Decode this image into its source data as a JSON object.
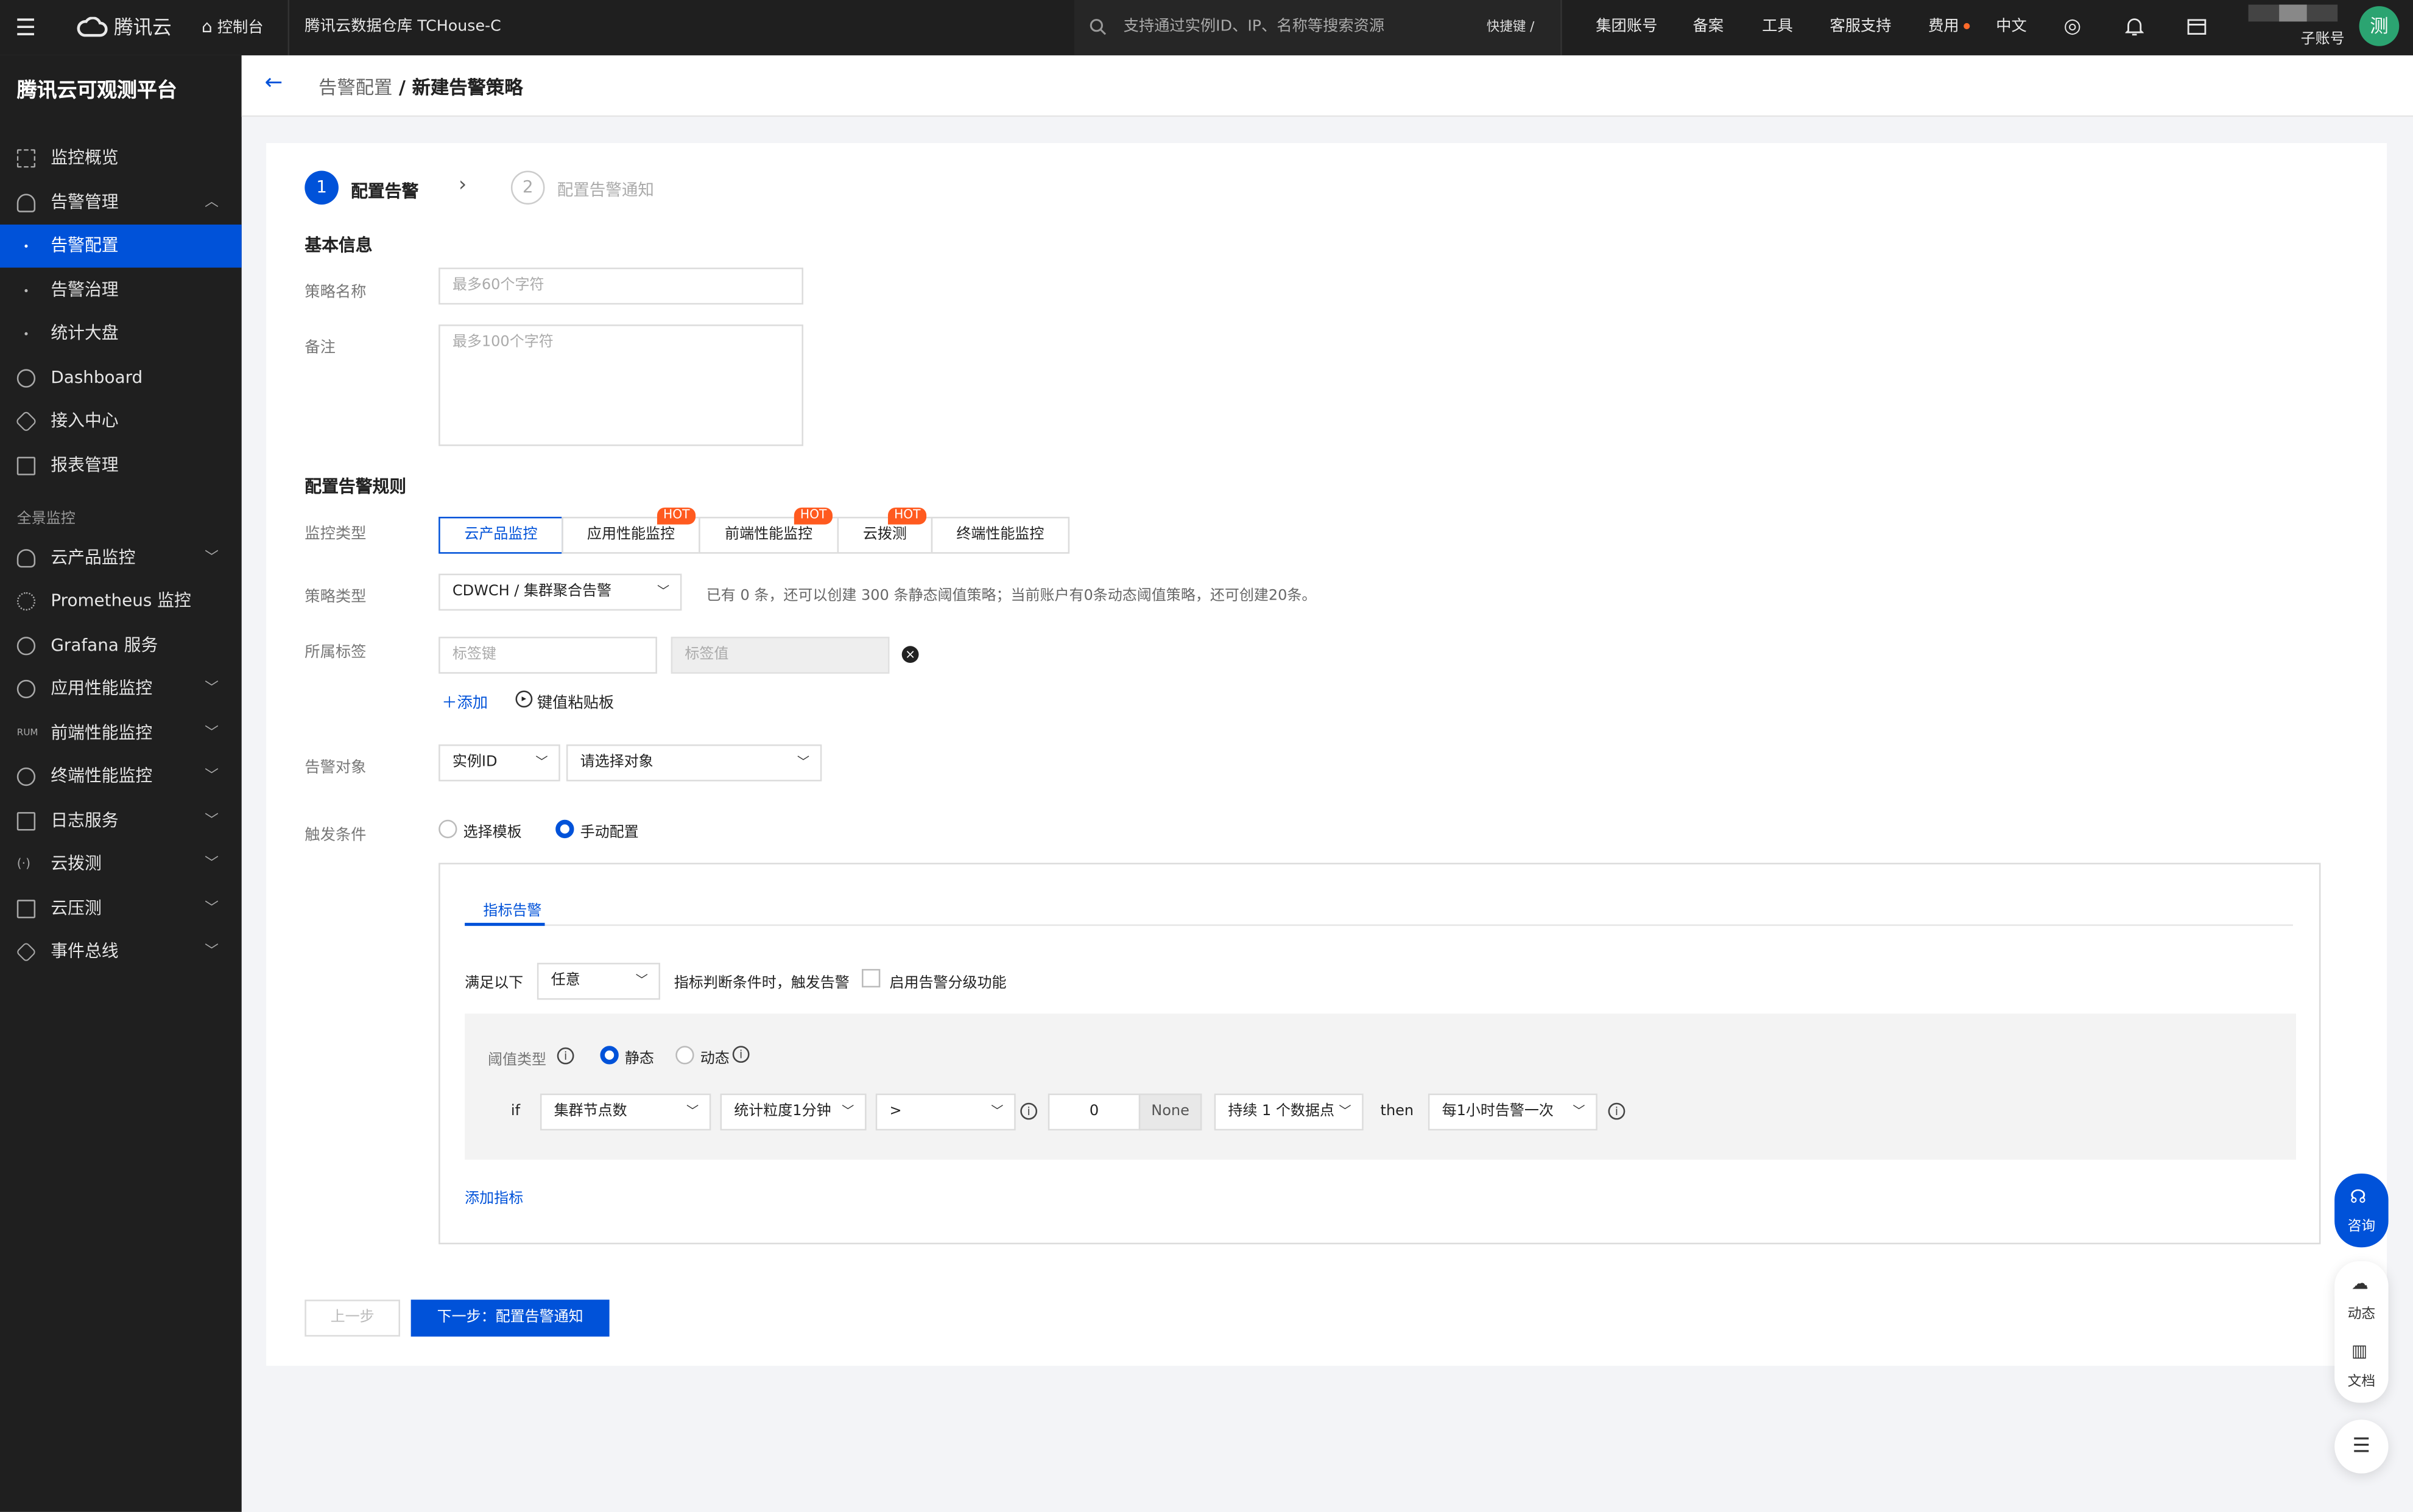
{
  "topbar": {
    "brand": "腾讯云",
    "console": "控制台",
    "product": "腾讯云数据仓库 TCHouse-C",
    "search_placeholder": "支持通过实例ID、IP、名称等搜索资源",
    "shortcut": "快捷键 /",
    "links": [
      "集团账号",
      "备案",
      "工具",
      "客服支持",
      "费用",
      "中文"
    ],
    "account": "子账号",
    "avatar": "测"
  },
  "sidebar": {
    "title": "腾讯云可观测平台",
    "items": [
      {
        "label": "监控概览"
      },
      {
        "label": "告警管理"
      },
      {
        "label": "告警配置"
      },
      {
        "label": "告警治理"
      },
      {
        "label": "统计大盘"
      },
      {
        "label": "Dashboard"
      },
      {
        "label": "接入中心"
      },
      {
        "label": "报表管理"
      }
    ],
    "group_label": "全景监控",
    "group_items": [
      {
        "label": "云产品监控"
      },
      {
        "label": "Prometheus 监控"
      },
      {
        "label": "Grafana 服务"
      },
      {
        "label": "应用性能监控"
      },
      {
        "label": "前端性能监控"
      },
      {
        "label": "终端性能监控"
      },
      {
        "label": "日志服务"
      },
      {
        "label": "云拨测"
      },
      {
        "label": "云压测"
      },
      {
        "label": "事件总线"
      }
    ]
  },
  "header": {
    "crumb_parent": "告警配置",
    "crumb_sep": " / ",
    "crumb_current": "新建告警策略"
  },
  "steps": {
    "step1_num": "1",
    "step1_label": "配置告警",
    "step2_num": "2",
    "step2_label": "配置告警通知"
  },
  "basic": {
    "title": "基本信息",
    "name_label": "策略名称",
    "name_placeholder": "最多60个字符",
    "remark_label": "备注",
    "remark_placeholder": "最多100个字符"
  },
  "rules": {
    "title": "配置告警规则",
    "monitor_type_label": "监控类型",
    "monitor_types": [
      "云产品监控",
      "应用性能监控",
      "前端性能监控",
      "云拨测",
      "终端性能监控"
    ],
    "hot_label": "HOT",
    "policy_type_label": "策略类型",
    "policy_type_value": "CDWCH / 集群聚合告警",
    "policy_hint": "已有 0 条，还可以创建 300 条静态阈值策略；当前账户有0条动态阈值策略，还可创建20条。",
    "tag_label": "所属标签",
    "tag_key_placeholder": "标签键",
    "tag_value_placeholder": "标签值",
    "add_label": "添加",
    "paste_label": "键值粘贴板",
    "target_label": "告警对象",
    "target_type": "实例ID",
    "target_placeholder": "请选择对象",
    "trigger_label": "触发条件",
    "trigger_template": "选择模板",
    "trigger_manual": "手动配置"
  },
  "metric_panel": {
    "tab": "指标告警",
    "satisfy_prefix": "满足以下",
    "satisfy_value": "任意",
    "satisfy_suffix": "指标判断条件时，触发告警",
    "grading_label": "启用告警分级功能",
    "threshold_label": "阈值类型",
    "static_label": "静态",
    "dynamic_label": "动态",
    "if_label": "if",
    "metric": "集群节点数",
    "granularity": "统计粒度1分钟",
    "operator": ">",
    "value": "0",
    "unit": "None",
    "duration": "持续 1 个数据点",
    "then_label": "then",
    "frequency": "每1小时告警一次",
    "add_metric": "添加指标"
  },
  "footer": {
    "prev": "上一步",
    "next": "下一步：配置告警通知"
  },
  "float": {
    "consult": "咨询",
    "news": "动态",
    "docs": "文档"
  }
}
